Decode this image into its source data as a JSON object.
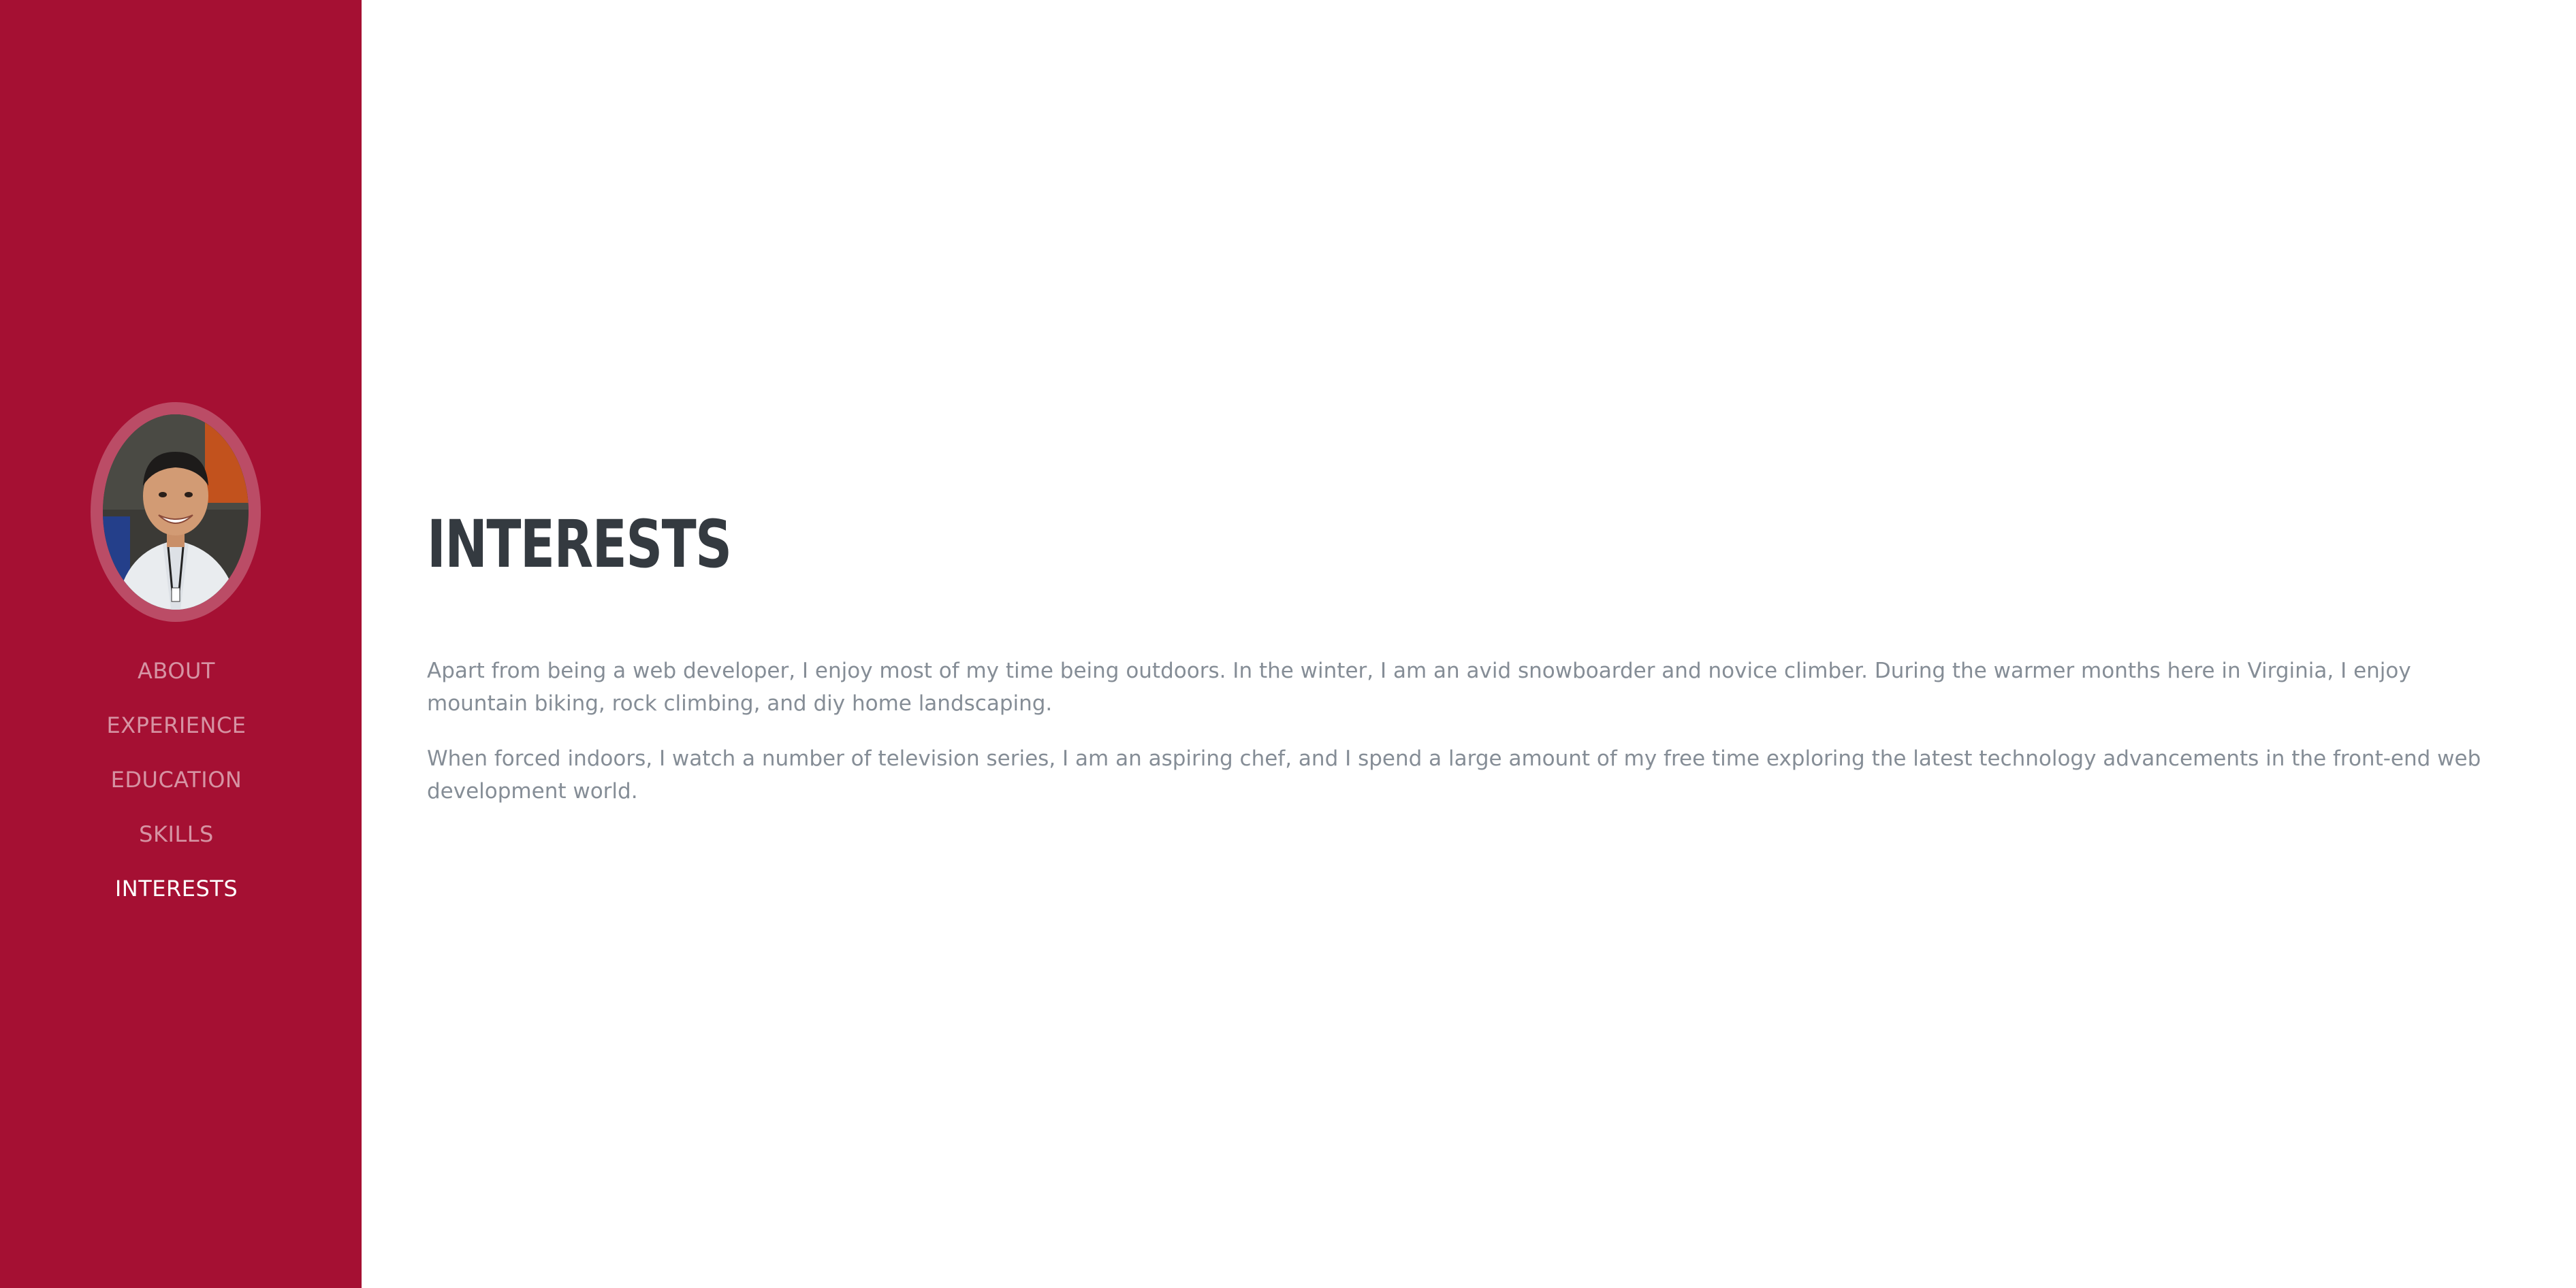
{
  "sidebar": {
    "avatar_alt": "profile photo",
    "items": [
      {
        "label": "ABOUT",
        "active": false
      },
      {
        "label": "EXPERIENCE",
        "active": false
      },
      {
        "label": "EDUCATION",
        "active": false
      },
      {
        "label": "SKILLS",
        "active": false
      },
      {
        "label": "INTERESTS",
        "active": true
      }
    ]
  },
  "main": {
    "title": "INTERESTS",
    "paragraphs": [
      "Apart from being a web developer, I enjoy most of my time being outdoors. In the winter, I am an avid snowboarder and novice climber. During the warmer months here in Virginia, I enjoy mountain biking, rock climbing, and diy home landscaping.",
      "When forced indoors, I watch a number of television series, I am an aspiring chef, and I spend a large amount of my free time exploring the latest technology advancements in the front-end web development world."
    ]
  },
  "colors": {
    "sidebar_bg": "#a51033",
    "title": "#343a40",
    "body_text": "#858d96"
  }
}
